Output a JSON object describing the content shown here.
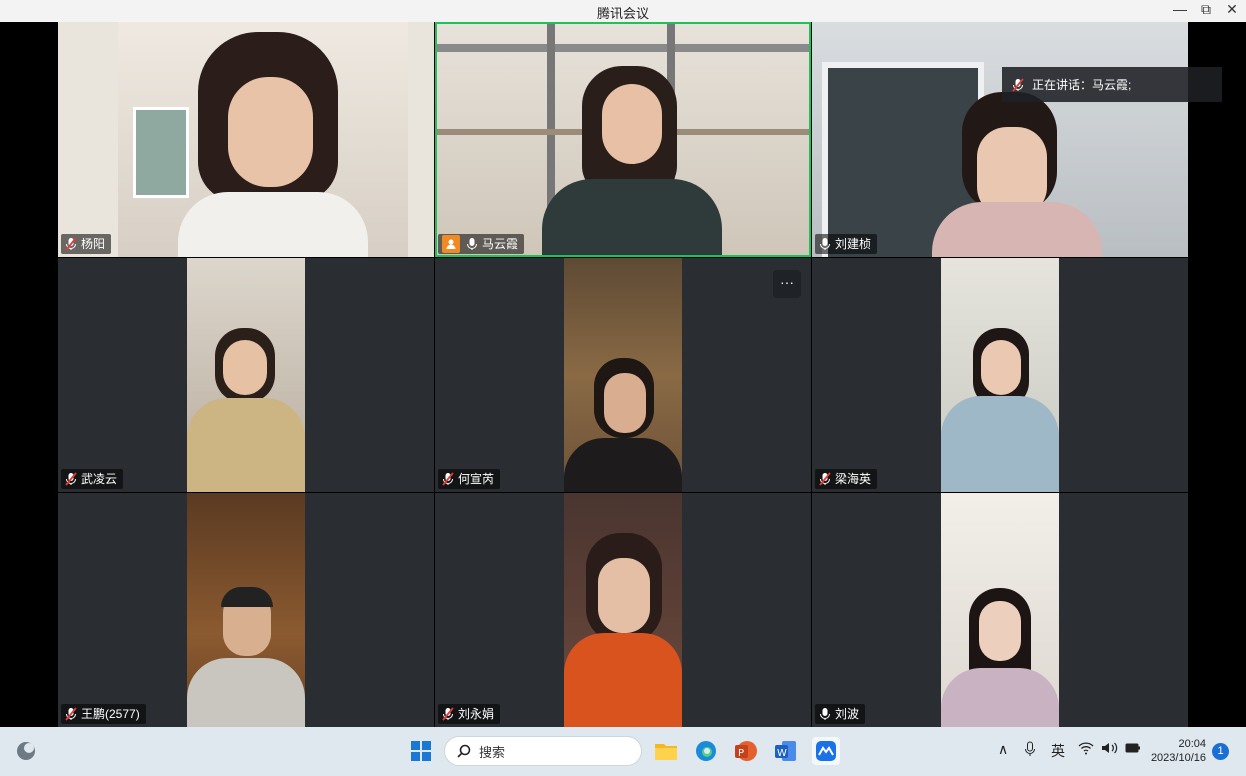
{
  "window": {
    "title": "腾讯会议",
    "minimize": "—",
    "restore": "⧉",
    "close": "✕"
  },
  "speaking_banner": {
    "label": "正在讲话：马云霞;"
  },
  "participants": [
    {
      "name": "杨阳",
      "mic": "muted"
    },
    {
      "name": "马云霞",
      "mic": "on",
      "host": true,
      "active": true
    },
    {
      "name": "刘建桢",
      "mic": "on"
    },
    {
      "name": "武凌云",
      "mic": "muted"
    },
    {
      "name": "何宣芮",
      "mic": "muted"
    },
    {
      "name": "梁海英",
      "mic": "muted"
    },
    {
      "name": "王鹏(2577)",
      "mic": "muted"
    },
    {
      "name": "刘永娟",
      "mic": "muted"
    },
    {
      "name": "刘波",
      "mic": "on"
    }
  ],
  "more_button": "···",
  "taskbar": {
    "search_placeholder": "搜索",
    "ime": "英",
    "time": "20:04",
    "date": "2023/10/16",
    "notification_count": "1",
    "up_arrow": "∧"
  },
  "colors": {
    "active_border": "#22c05a",
    "host_badge": "#f08a24",
    "taskbar_bg": "#dfe8ef"
  }
}
